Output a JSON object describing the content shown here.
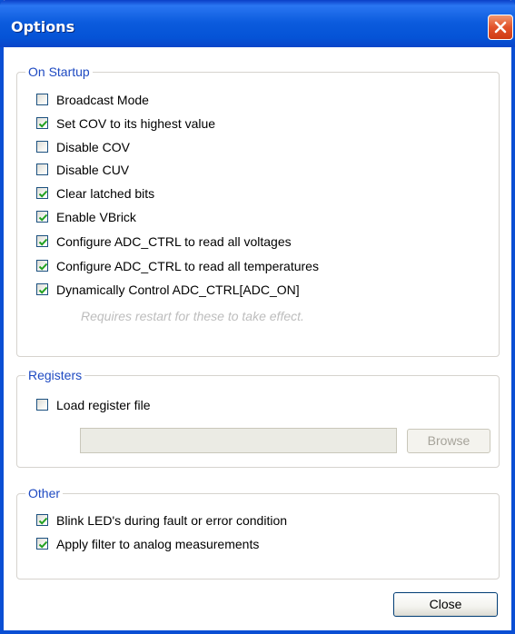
{
  "window": {
    "title": "Options",
    "close_icon": "close-icon"
  },
  "startup": {
    "legend": "On Startup",
    "items": [
      {
        "label": "Broadcast Mode",
        "checked": false
      },
      {
        "label": "Set COV to its highest value",
        "checked": true
      },
      {
        "label": "Disable COV",
        "checked": false
      },
      {
        "label": "Disable CUV",
        "checked": false
      },
      {
        "label": "Clear latched bits",
        "checked": true
      },
      {
        "label": "Enable VBrick",
        "checked": true
      },
      {
        "label": "Configure ADC_CTRL to read all voltages",
        "checked": true
      },
      {
        "label": "Configure ADC_CTRL to read all temperatures",
        "checked": true
      },
      {
        "label": "Dynamically Control ADC_CTRL[ADC_ON]",
        "checked": true
      }
    ],
    "hint": "Requires restart for these to take effect."
  },
  "registers": {
    "legend": "Registers",
    "load_label": "Load register file",
    "load_checked": false,
    "path_value": "",
    "browse_label": "Browse"
  },
  "other": {
    "legend": "Other",
    "items": [
      {
        "label": "Blink LED's during fault or error condition",
        "checked": true
      },
      {
        "label": "Apply filter to analog measurements",
        "checked": true
      }
    ]
  },
  "footer": {
    "close_label": "Close"
  },
  "colors": {
    "titlebar": "#0b5bdd",
    "legend_text": "#1e4ac2",
    "checkbox_border": "#1c5180",
    "checkmark": "#21a121",
    "hint_text": "#bdbdbd"
  }
}
